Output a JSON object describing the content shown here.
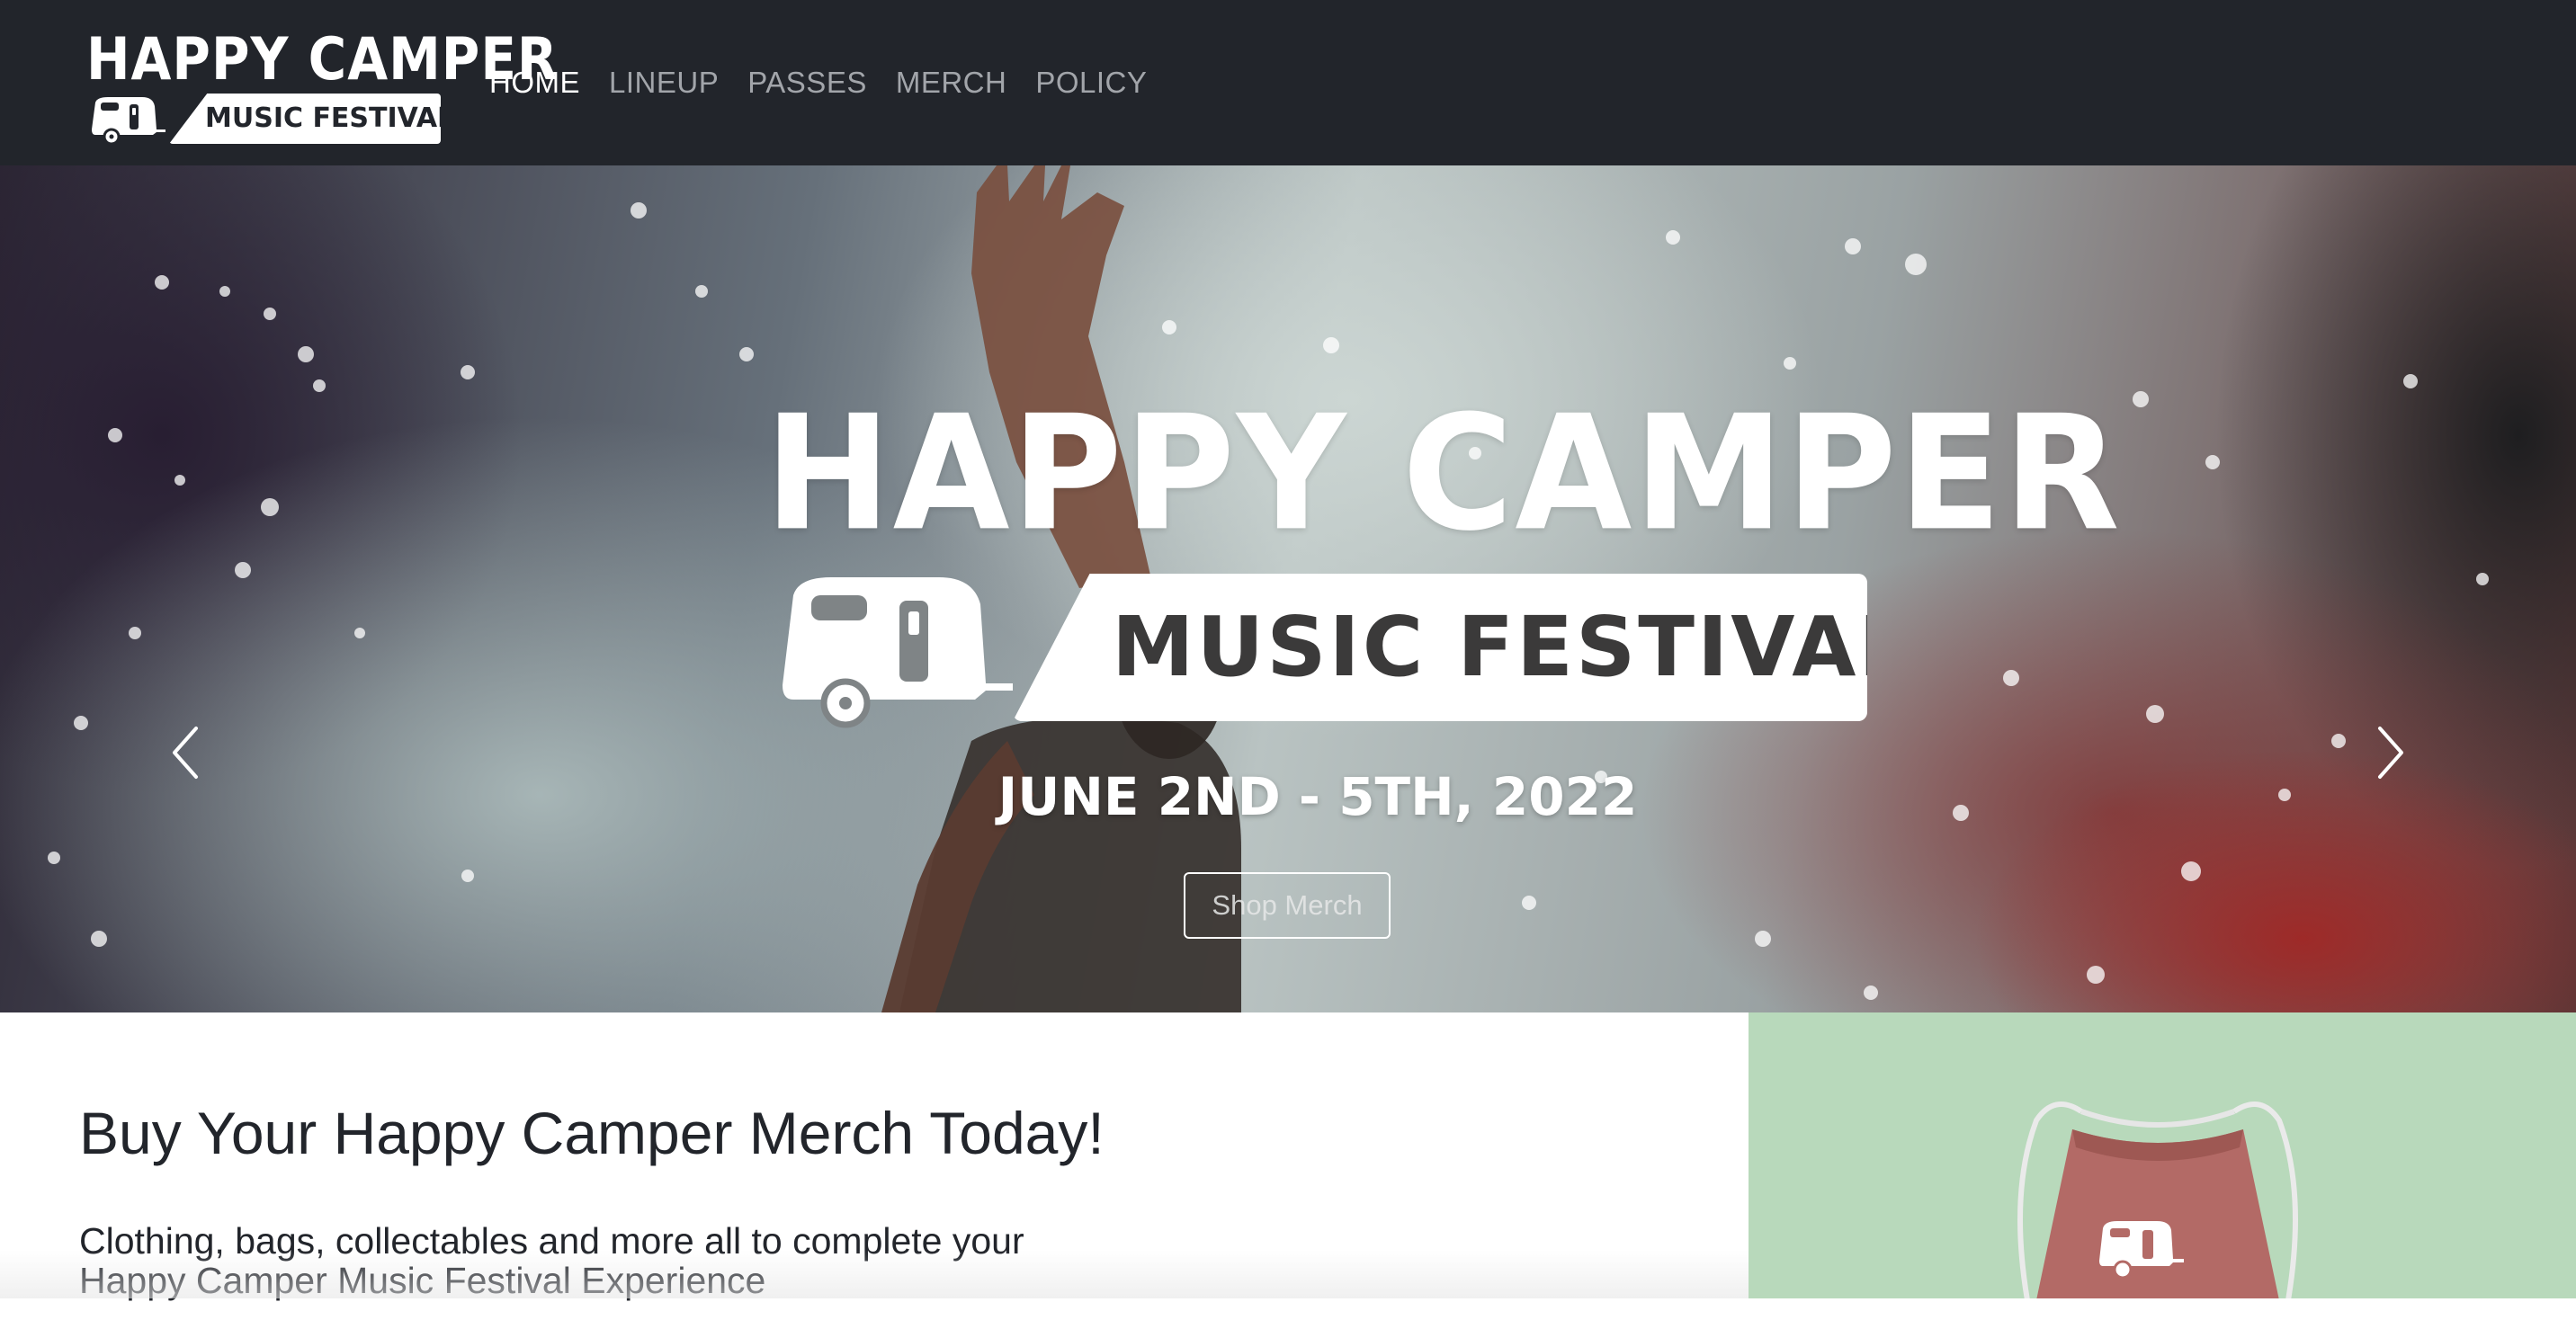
{
  "brand": {
    "title": "HAPPY CAMPER",
    "badge": "MUSIC FESTIVAL",
    "icon": "camper-trailer-icon"
  },
  "nav": {
    "items": [
      {
        "label": "HOME",
        "active": true
      },
      {
        "label": "LINEUP",
        "active": false
      },
      {
        "label": "PASSES",
        "active": false
      },
      {
        "label": "MERCH",
        "active": false
      },
      {
        "label": "POLICY",
        "active": false
      }
    ]
  },
  "hero": {
    "title": "HAPPY CAMPER",
    "badge": "MUSIC FESTIVAL",
    "date": "JUNE 2ND - 5TH, 2022",
    "cta_label": "Shop Merch",
    "prev_icon": "chevron-left-icon",
    "next_icon": "chevron-right-icon"
  },
  "merch": {
    "heading": "Buy Your Happy Camper Merch Today!",
    "description": "Clothing, bags, collectables and more all to complete your Happy Camper Music Festival Experience",
    "image_icon": "drawstring-bag-icon"
  },
  "colors": {
    "navbar_bg": "#22252b",
    "nav_active": "#ffffff",
    "nav_inactive": "#a2a5aa",
    "merch_panel_bg": "#b8d9bb",
    "bag_color": "#b36a66",
    "text_dark": "#22252b"
  }
}
